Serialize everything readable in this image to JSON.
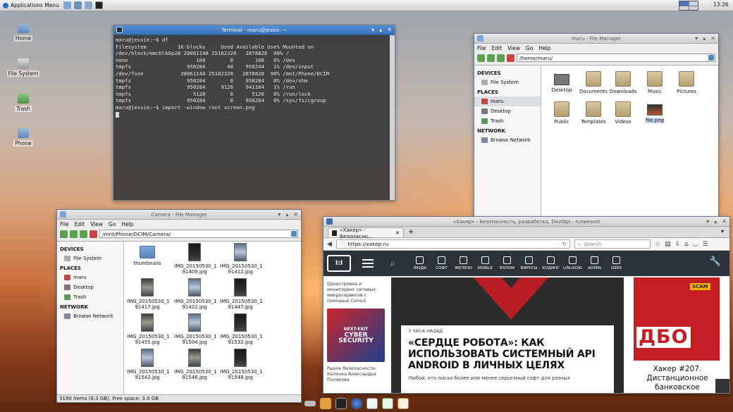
{
  "top_panel": {
    "app_menu": "Applications Menu",
    "clock": "13:26"
  },
  "desktop_icons": [
    "Home",
    "File System",
    "Trash",
    "Phone"
  ],
  "terminal": {
    "title": "Terminal - maru@jessie: ~",
    "lines": [
      "maru@jessie:~$ df",
      "Filesystem          1K-blocks     Used Available Use% Mounted on",
      "/dev/block/mmcblk0p28 28061148 25182320   2878828  90% /",
      "none                      100        0       100   0% /dev",
      "tmpfs                  950284       40    950244   1% /dev/input",
      "/dev/fuse            28061148 25182320   2878828  90% /mnt/Phone/DCIM",
      "tmpfs                  950284        0    950284   0% /dev/shm",
      "tmpfs                  950284     9120    941164   1% /run",
      "tmpfs                    5120        0      5120   0% /run/lock",
      "tmpfs                  950284        0    950284   0% /sys/fs/cgroup",
      "maru@jessie:~$ import -window root screen.png"
    ]
  },
  "fm_home": {
    "title": "maru - File Manager",
    "menu": [
      "File",
      "Edit",
      "View",
      "Go",
      "Help"
    ],
    "path": "/home/maru/",
    "side": {
      "devices_hd": "DEVICES",
      "filesystem": "File System",
      "places_hd": "PLACES",
      "places": [
        "maru",
        "Desktop",
        "Trash"
      ],
      "network_hd": "NETWORK",
      "browse": "Browse Network"
    },
    "items": [
      "Desktop",
      "Documents",
      "Downloads",
      "Music",
      "Pictures",
      "Public",
      "Templates",
      "Videos",
      "file.png"
    ]
  },
  "fm_camera": {
    "title": "Camera - File Manager",
    "menu": [
      "File",
      "Edit",
      "View",
      "Go",
      "Help"
    ],
    "path": "/mnt/Phone/DCIM/Camera/",
    "side": {
      "devices_hd": "DEVICES",
      "filesystem": "File System",
      "places_hd": "PLACES",
      "places": [
        "maru",
        "Desktop",
        "Trash"
      ],
      "network_hd": "NETWORK",
      "browse": "Browse Network"
    },
    "items": [
      [
        "thumbnails",
        ""
      ],
      [
        "IMG_20150530_1",
        "91409.jpg"
      ],
      [
        "IMG_20150530_1",
        "91412.jpg"
      ],
      [
        "IMG_20150530_1",
        "91417.jpg"
      ],
      [
        "IMG_20150530_1",
        "91422.jpg"
      ],
      [
        "IMG_20150530_1",
        "91447.jpg"
      ],
      [
        "IMG_20150530_1",
        "91455.jpg"
      ],
      [
        "IMG_20150530_1",
        "91504.jpg"
      ],
      [
        "IMG_20150530_1",
        "91532.jpg"
      ],
      [
        "IMG_20150530_1",
        "91542.jpg"
      ],
      [
        "IMG_20150530_1",
        "91546.jpg"
      ],
      [
        "IMG_20150530_1",
        "91548.jpg"
      ]
    ],
    "status": "3190 items (8.3 GB), Free space: 3.0 GB"
  },
  "browser": {
    "title": "«Хакер» - Безопасность, разработка, DevOps - Iceweasel",
    "tab": "«Хакер» - Безопасно...",
    "url": "https://xakep.ru",
    "search_placeholder": "Search",
    "logo": "I:I",
    "categories": [
      "ЛЮДИ",
      "СОФТ",
      "ЖЕЛЕЗО",
      "MOBILE",
      "ВЗЛОМ",
      "ВИРУСЫ",
      "КОДИНГ",
      "LINUXOID",
      "ADMIN",
      "GEEK"
    ],
    "left_text": "Оркестровка и мониторинг сетевых микросервисов с помощью Consul",
    "ad_line1": "NEXT-EXIT",
    "ad_line2": "CYBER",
    "ad_line3": "SECURITY",
    "left_text2": "Рынок безопасности. Колонка Александра Полякова",
    "article_ago": "3 ЧАСА НАЗАД",
    "article_head": "«СЕРДЦЕ РОБОТА»: КАК ИСПОЛЬЗОВАТЬ СИСТЕМНЫЙ API ANDROID В ЛИЧНЫХ ЦЕЛЯХ",
    "article_lead": "Любой, кто писал более или менее серьезный софт для разных",
    "mag_scam": "SCAM",
    "mag_dbo": "ДБО",
    "mag_title": "Хакер #207. Дистанционное банковское"
  }
}
